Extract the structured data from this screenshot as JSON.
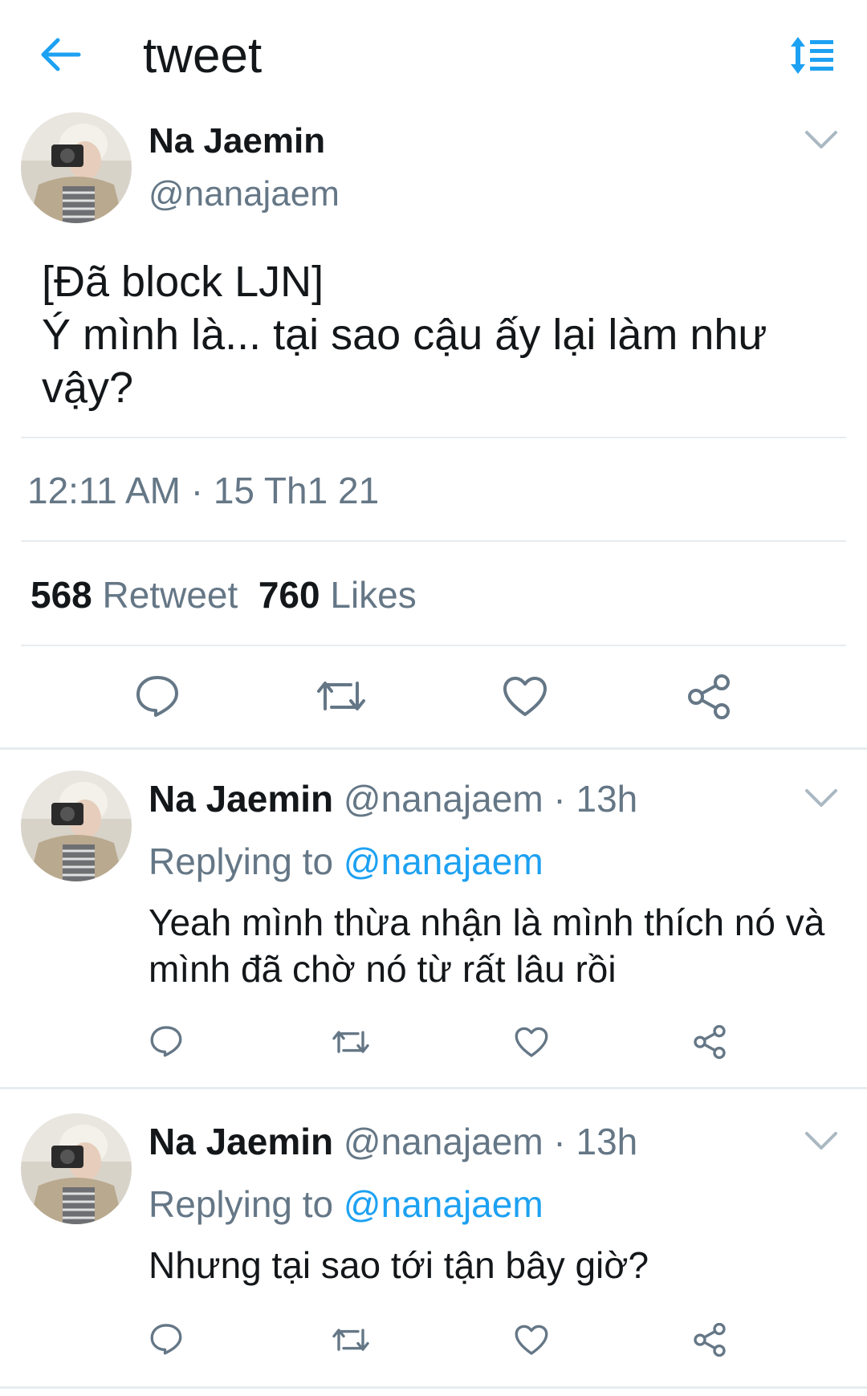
{
  "header": {
    "title": "tweet",
    "back_icon": "arrow-left-icon",
    "sort_icon": "sort-icon",
    "accent": "#1da1f2"
  },
  "main_tweet": {
    "author": "Na Jaemin",
    "handle": "@nanajaem",
    "text": "[Đã block LJN]\nÝ mình là... tại sao cậu ấy lại làm như vậy?",
    "timestamp": "12:11 AM · 15 Th1 21",
    "retweets_count": "568",
    "retweets_label": "Retweet",
    "likes_count": "760",
    "likes_label": "Likes"
  },
  "replies": [
    {
      "author": "Na Jaemin",
      "meta": "@nanajaem · 13h",
      "replying_prefix": "Replying to",
      "replying_handle": "@nanajaem",
      "text": "Yeah mình thừa nhận là mình thích nó và mình đã chờ nó từ rất lâu rồi"
    },
    {
      "author": "Na Jaemin",
      "meta": "@nanajaem · 13h",
      "replying_prefix": "Replying to",
      "replying_handle": "@nanajaem",
      "text": "Nhưng tại sao tới tận bây giờ?"
    }
  ],
  "colors": {
    "text": "#14171a",
    "secondary": "#657786",
    "link": "#1da1f2",
    "divider": "#e6ecf0"
  }
}
